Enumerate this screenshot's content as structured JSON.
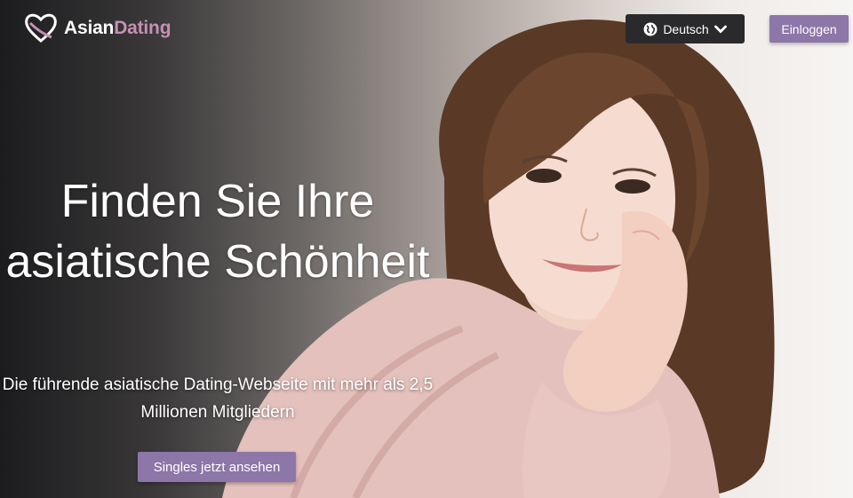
{
  "brand": {
    "name_part1": "Asian",
    "name_part2": "Dating",
    "accent_color": "#c690b5"
  },
  "header": {
    "language_button": {
      "label": "Deutsch",
      "icon": "globe-icon",
      "caret": "chevron-down-icon"
    },
    "login_button": {
      "label": "Einloggen"
    }
  },
  "hero": {
    "headline": "Finden Sie Ihre asiatische Schönheit",
    "subheadline": "Die führende asiatische Dating-Webseite mit mehr als 2,5 Millionen Mitgliedern",
    "cta_label": "Singles jetzt ansehen",
    "button_color": "#8d76a8",
    "image": "smiling-woman-photo"
  }
}
